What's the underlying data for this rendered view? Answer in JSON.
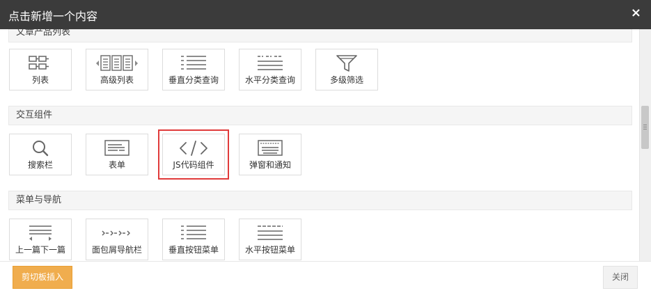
{
  "dialog": {
    "title": "点击新增一个内容",
    "close_glyph": "×"
  },
  "sections": [
    {
      "title": "文章产品列表",
      "items": [
        {
          "label": "列表",
          "icon": "list-icon"
        },
        {
          "label": "高级列表",
          "icon": "advanced-list-icon"
        },
        {
          "label": "垂直分类查询",
          "icon": "vertical-category-query-icon"
        },
        {
          "label": "水平分类查询",
          "icon": "horizontal-category-query-icon"
        },
        {
          "label": "多级筛选",
          "icon": "filter-funnel-icon"
        }
      ]
    },
    {
      "title": "交互组件",
      "items": [
        {
          "label": "搜索栏",
          "icon": "search-icon"
        },
        {
          "label": "表单",
          "icon": "form-icon"
        },
        {
          "label": "JS代码组件",
          "icon": "code-icon",
          "selected": true
        },
        {
          "label": "弹窗和通知",
          "icon": "popup-notification-icon"
        }
      ]
    },
    {
      "title": "菜单与导航",
      "items": [
        {
          "label": "上一篇下一篇",
          "icon": "prev-next-icon"
        },
        {
          "label": "面包屑导航栏",
          "icon": "breadcrumb-icon"
        },
        {
          "label": "垂直按钮菜单",
          "icon": "vertical-button-menu-icon"
        },
        {
          "label": "水平按钮菜单",
          "icon": "horizontal-button-menu-icon"
        }
      ]
    }
  ],
  "footer": {
    "paste_label": "剪切板插入",
    "close_label": "关闭"
  },
  "colors": {
    "titlebar_bg": "#3b3b3b",
    "paste_button_bg": "#f0ad4e",
    "selected_outline": "#e03a3a"
  }
}
